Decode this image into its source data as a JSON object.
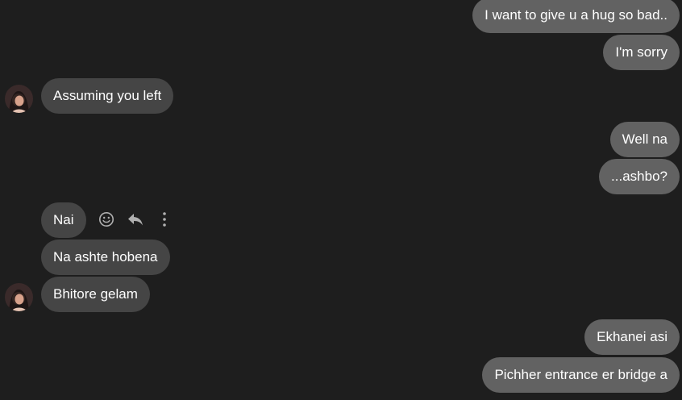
{
  "messages": [
    {
      "text": "I want to give u a hug so bad..",
      "direction": "outgoing"
    },
    {
      "text": "I'm sorry",
      "direction": "outgoing"
    },
    {
      "text": "Assuming you left",
      "direction": "incoming"
    },
    {
      "text": "Well na",
      "direction": "outgoing"
    },
    {
      "text": "...ashbo?",
      "direction": "outgoing"
    },
    {
      "text": "Nai",
      "direction": "incoming"
    },
    {
      "text": "Na ashte hobena",
      "direction": "incoming"
    },
    {
      "text": "Bhitore gelam",
      "direction": "incoming"
    },
    {
      "text": "Ekhanei asi",
      "direction": "outgoing"
    },
    {
      "text": "Pichher entrance er bridge a",
      "direction": "outgoing"
    }
  ],
  "message_actions": [
    "smiley-react-icon",
    "reply-arrow-icon",
    "more-vertical-icon"
  ],
  "colors": {
    "background": "#1e1e1e",
    "outgoing_bubble": "#626262",
    "incoming_bubble": "#454545",
    "text": "#ffffff",
    "action_icon": "#b0b0b0"
  }
}
